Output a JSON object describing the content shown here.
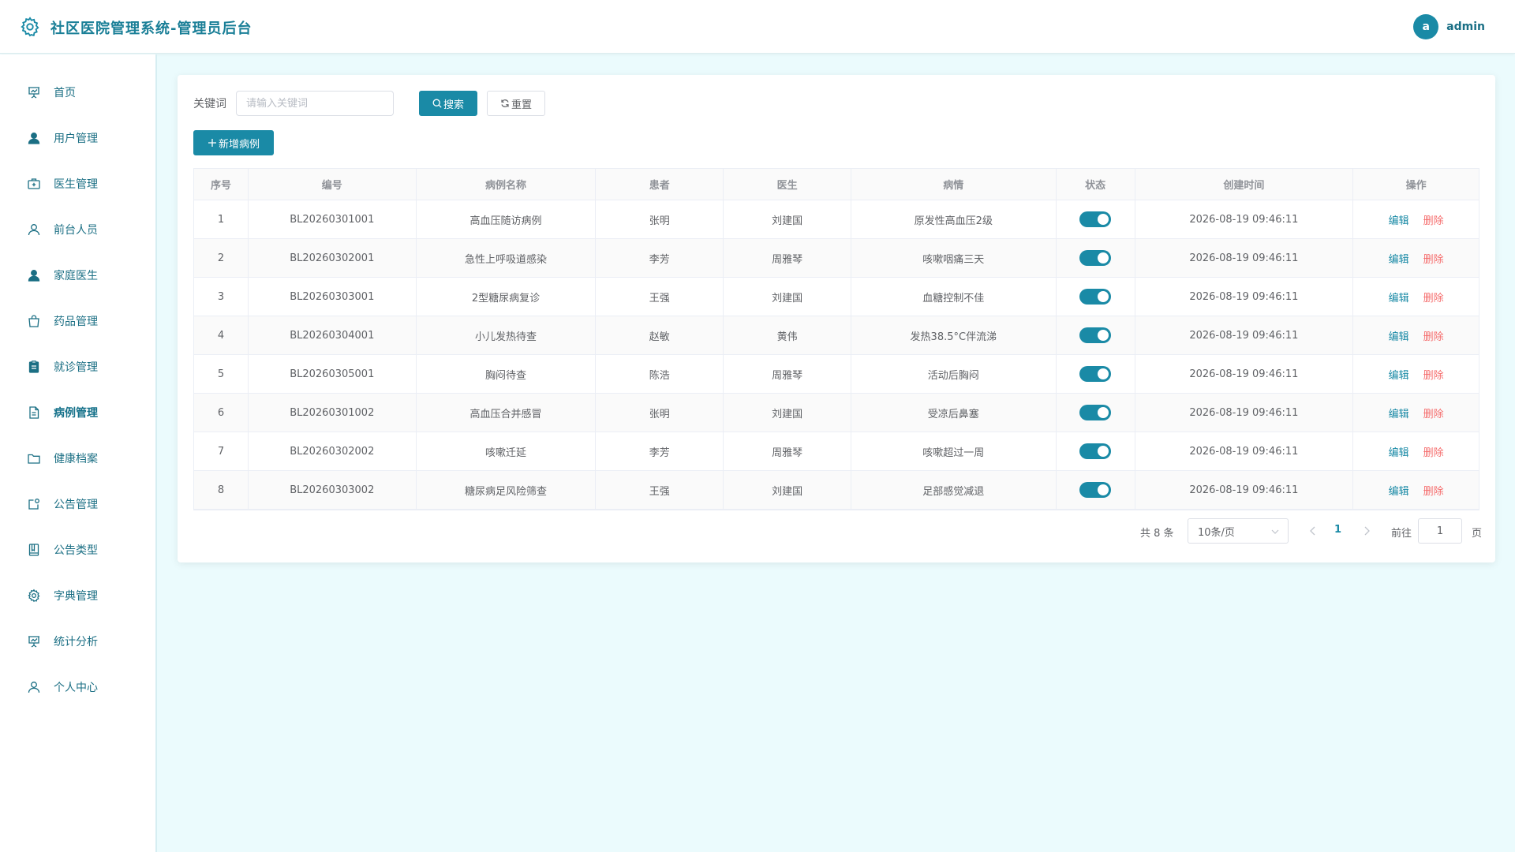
{
  "header": {
    "title": "社区医院管理系统-管理员后台",
    "avatar_letter": "a",
    "username": "admin"
  },
  "sidebar": {
    "items": [
      {
        "label": "首页",
        "icon": "presentation-icon"
      },
      {
        "label": "用户管理",
        "icon": "user-filled-icon"
      },
      {
        "label": "医生管理",
        "icon": "first-aid-kit-icon"
      },
      {
        "label": "前台人员",
        "icon": "user-icon"
      },
      {
        "label": "家庭医生",
        "icon": "user-filled-icon"
      },
      {
        "label": "药品管理",
        "icon": "shopping-bag-icon"
      },
      {
        "label": "就诊管理",
        "icon": "clipboard-icon"
      },
      {
        "label": "病例管理",
        "icon": "document-icon",
        "active": true
      },
      {
        "label": "健康档案",
        "icon": "folder-icon"
      },
      {
        "label": "公告管理",
        "icon": "notification-icon"
      },
      {
        "label": "公告类型",
        "icon": "notebook-icon"
      },
      {
        "label": "字典管理",
        "icon": "gear-icon"
      },
      {
        "label": "统计分析",
        "icon": "presentation-icon"
      },
      {
        "label": "个人中心",
        "icon": "user-icon"
      }
    ]
  },
  "search": {
    "label": "关键词",
    "placeholder": "请输入关键词",
    "search_button": "搜索",
    "reset_button": "重置",
    "add_button": "新增病例"
  },
  "table": {
    "columns": [
      "序号",
      "编号",
      "病例名称",
      "患者",
      "医生",
      "病情",
      "状态",
      "创建时间",
      "操作"
    ],
    "edit_label": "编辑",
    "delete_label": "删除",
    "rows": [
      {
        "index": "1",
        "code": "BL20260301001",
        "name": "高血压随访病例",
        "patient": "张明",
        "doctor": "刘建国",
        "condition": "原发性高血压2级",
        "status": true,
        "created": "2026-08-19 09:46:11"
      },
      {
        "index": "2",
        "code": "BL20260302001",
        "name": "急性上呼吸道感染",
        "patient": "李芳",
        "doctor": "周雅琴",
        "condition": "咳嗽咽痛三天",
        "status": true,
        "created": "2026-08-19 09:46:11"
      },
      {
        "index": "3",
        "code": "BL20260303001",
        "name": "2型糖尿病复诊",
        "patient": "王强",
        "doctor": "刘建国",
        "condition": "血糖控制不佳",
        "status": true,
        "created": "2026-08-19 09:46:11"
      },
      {
        "index": "4",
        "code": "BL20260304001",
        "name": "小儿发热待查",
        "patient": "赵敏",
        "doctor": "黄伟",
        "condition": "发热38.5°C伴流涕",
        "status": true,
        "created": "2026-08-19 09:46:11"
      },
      {
        "index": "5",
        "code": "BL20260305001",
        "name": "胸闷待查",
        "patient": "陈浩",
        "doctor": "周雅琴",
        "condition": "活动后胸闷",
        "status": true,
        "created": "2026-08-19 09:46:11"
      },
      {
        "index": "6",
        "code": "BL20260301002",
        "name": "高血压合并感冒",
        "patient": "张明",
        "doctor": "刘建国",
        "condition": "受凉后鼻塞",
        "status": true,
        "created": "2026-08-19 09:46:11"
      },
      {
        "index": "7",
        "code": "BL20260302002",
        "name": "咳嗽迁延",
        "patient": "李芳",
        "doctor": "周雅琴",
        "condition": "咳嗽超过一周",
        "status": true,
        "created": "2026-08-19 09:46:11"
      },
      {
        "index": "8",
        "code": "BL20260303002",
        "name": "糖尿病足风险筛查",
        "patient": "王强",
        "doctor": "刘建国",
        "condition": "足部感觉减退",
        "status": true,
        "created": "2026-08-19 09:46:11"
      }
    ]
  },
  "pagination": {
    "total_text": "共 8 条",
    "page_size": "10条/页",
    "current_page": "1",
    "goto_label": "前往",
    "goto_value": "1",
    "page_suffix": "页"
  },
  "colors": {
    "primary": "#1a8aa6",
    "danger": "#f56c6c",
    "background": "#ebfbfd"
  }
}
